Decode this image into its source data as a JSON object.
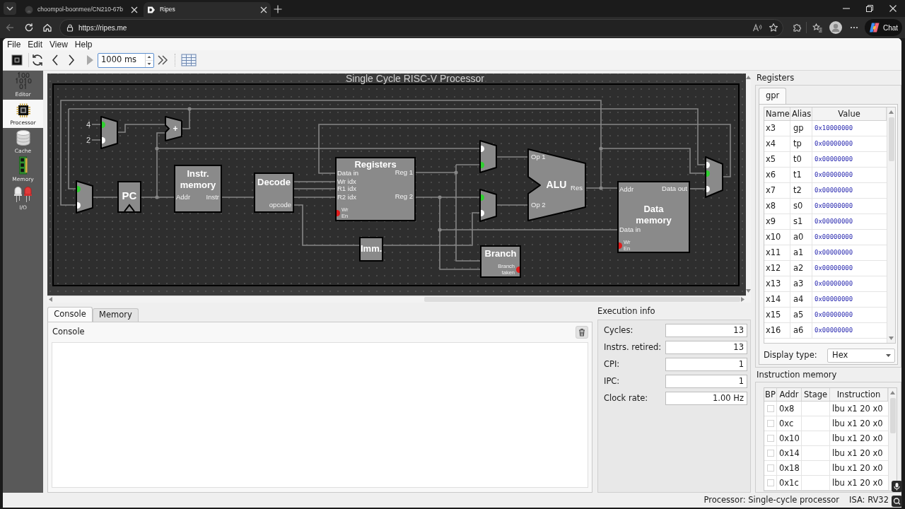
{
  "browser": {
    "tabs": [
      {
        "title": "choompol-boonmee/CN210-67b",
        "selected": false
      },
      {
        "title": "Ripes",
        "selected": true
      }
    ],
    "url": "https://ripes.me",
    "chat_button": "Chat"
  },
  "menu": [
    "File",
    "Edit",
    "View",
    "Help"
  ],
  "toolbar": {
    "interval": "1000 ms"
  },
  "sidebar": [
    {
      "label": "Editor",
      "selected": false
    },
    {
      "label": "Processor",
      "selected": true
    },
    {
      "label": "Cache",
      "selected": false
    },
    {
      "label": "Memory",
      "selected": false
    },
    {
      "label": "I/O",
      "selected": false
    }
  ],
  "diagram": {
    "title": "Single Cycle RISC-V Processor",
    "components": [
      {
        "kind": "constant",
        "label": "4"
      },
      {
        "kind": "constant",
        "label": "2"
      },
      {
        "kind": "mux",
        "inputs": [
          {
            "selected": true
          },
          {
            "selected": false
          }
        ]
      },
      {
        "kind": "adder",
        "label": "+"
      },
      {
        "kind": "mux",
        "inputs": [
          {
            "selected": true
          },
          {
            "selected": false
          }
        ]
      },
      {
        "kind": "register",
        "label": "PC"
      },
      {
        "kind": "block",
        "label": "Instr. memory",
        "inputs": [
          "Addr"
        ],
        "outputs": [
          "Instr"
        ]
      },
      {
        "kind": "block",
        "label": "Decode",
        "outputs": [
          "opcode"
        ]
      },
      {
        "kind": "block",
        "label": "Registers",
        "inputs": [
          "Data in",
          "Wr idx",
          "R1 idx",
          "R2 idx"
        ],
        "outputs": [
          "Reg 1",
          "Reg 2"
        ],
        "controls": [
          {
            "label": "Wr En",
            "on": false
          }
        ]
      },
      {
        "kind": "block",
        "label": "Imm."
      },
      {
        "kind": "mux",
        "inputs": [
          {
            "selected": false
          },
          {
            "selected": true
          }
        ]
      },
      {
        "kind": "mux",
        "inputs": [
          {
            "selected": true
          },
          {
            "selected": false
          }
        ]
      },
      {
        "kind": "alu",
        "label": "ALU",
        "inputs": [
          "Op 1",
          "Op 2"
        ],
        "outputs": [
          "Res"
        ]
      },
      {
        "kind": "block",
        "label": "Data memory",
        "inputs": [
          "Addr",
          "Data in"
        ],
        "outputs": [
          "Data out"
        ],
        "controls": [
          {
            "label": "Wr En",
            "on": false
          }
        ]
      },
      {
        "kind": "mux",
        "inputs": [
          {
            "selected": false
          },
          {
            "selected": true
          },
          {
            "selected": false
          }
        ]
      },
      {
        "kind": "block",
        "label": "Branch",
        "controls": [
          {
            "label": "Branch taken",
            "on": false
          }
        ]
      }
    ]
  },
  "bottom_tabs": [
    {
      "label": "Console",
      "selected": true
    },
    {
      "label": "Memory",
      "selected": false
    }
  ],
  "console": {
    "title": "Console"
  },
  "execution_info": {
    "title": "Execution info",
    "fields": [
      {
        "label": "Cycles:",
        "value": "13"
      },
      {
        "label": "Instrs. retired:",
        "value": "13"
      },
      {
        "label": "CPI:",
        "value": "1"
      },
      {
        "label": "IPC:",
        "value": "1"
      },
      {
        "label": "Clock rate:",
        "value": "1.00 Hz"
      }
    ]
  },
  "registers": {
    "title": "Registers",
    "tabs": [
      {
        "label": "gpr",
        "selected": true
      }
    ],
    "columns": [
      "Name",
      "Alias",
      "Value"
    ],
    "rows": [
      {
        "name": "x3",
        "alias": "gp",
        "value": "0x10000000"
      },
      {
        "name": "x4",
        "alias": "tp",
        "value": "0x00000000"
      },
      {
        "name": "x5",
        "alias": "t0",
        "value": "0x00000000"
      },
      {
        "name": "x6",
        "alias": "t1",
        "value": "0x00000000"
      },
      {
        "name": "x7",
        "alias": "t2",
        "value": "0x00000000"
      },
      {
        "name": "x8",
        "alias": "s0",
        "value": "0x00000000"
      },
      {
        "name": "x9",
        "alias": "s1",
        "value": "0x00000000"
      },
      {
        "name": "x10",
        "alias": "a0",
        "value": "0x00000000"
      },
      {
        "name": "x11",
        "alias": "a1",
        "value": "0x00000000"
      },
      {
        "name": "x12",
        "alias": "a2",
        "value": "0x00000000"
      },
      {
        "name": "x13",
        "alias": "a3",
        "value": "0x00000000"
      },
      {
        "name": "x14",
        "alias": "a4",
        "value": "0x00000000"
      },
      {
        "name": "x15",
        "alias": "a5",
        "value": "0x00000000"
      },
      {
        "name": "x16",
        "alias": "a6",
        "value": "0x00000000"
      }
    ],
    "display_type": {
      "label": "Display type:",
      "value": "Hex"
    }
  },
  "instruction_memory": {
    "title": "Instruction memory",
    "columns": [
      "BP",
      "Addr",
      "Stage",
      "Instruction"
    ],
    "rows": [
      {
        "checked": false,
        "addr": "0x8",
        "instruction": "lbu x1 20 x0"
      },
      {
        "checked": false,
        "addr": "0xc",
        "instruction": "lbu x1 20 x0"
      },
      {
        "checked": false,
        "addr": "0x10",
        "instruction": "lbu x1 20 x0"
      },
      {
        "checked": false,
        "addr": "0x14",
        "instruction": "lbu x1 20 x0"
      },
      {
        "checked": false,
        "addr": "0x18",
        "instruction": "lbu x1 20 x0"
      },
      {
        "checked": false,
        "addr": "0x1c",
        "instruction": "lbu x1 20 x0"
      }
    ]
  },
  "status_bar": {
    "processor": "Processor: Single-cycle processor",
    "isa": "ISA: RV32"
  }
}
